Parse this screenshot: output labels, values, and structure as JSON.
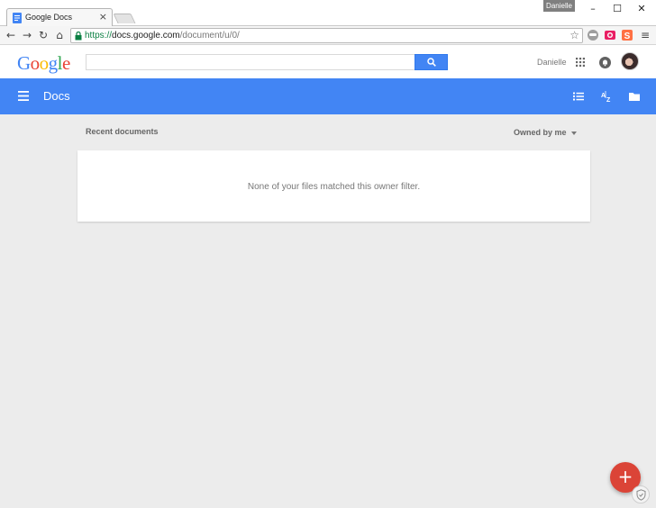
{
  "browser": {
    "tab_title": "Google Docs",
    "tab_close": "×",
    "profile_badge": "Danielle",
    "window_controls": {
      "minimize": "–",
      "maximize": "☐",
      "close": "✕"
    },
    "nav": {
      "back": "←",
      "forward": "→",
      "reload": "↻",
      "home": "⌂"
    },
    "url": {
      "scheme": "https://",
      "domain": "docs.google.com",
      "path": "/document/u/0/"
    },
    "bookmark_star": "☆",
    "menu": "≡"
  },
  "header": {
    "logo_letters": [
      "G",
      "o",
      "o",
      "g",
      "l",
      "e"
    ],
    "logo_colors": [
      "#4285f4",
      "#ea4335",
      "#fbbc05",
      "#4285f4",
      "#34a853",
      "#ea4335"
    ],
    "search_placeholder": "",
    "user_name": "Danielle"
  },
  "docs_bar": {
    "title": "Docs",
    "color": "#4285f4",
    "icons": [
      "list-view-icon",
      "sort-az-icon",
      "folder-icon"
    ]
  },
  "main": {
    "section_label": "Recent documents",
    "owner_filter": "Owned by me",
    "empty_message": "None of your files matched this owner filter."
  },
  "fab": {
    "label": "+",
    "color": "#db4437"
  }
}
